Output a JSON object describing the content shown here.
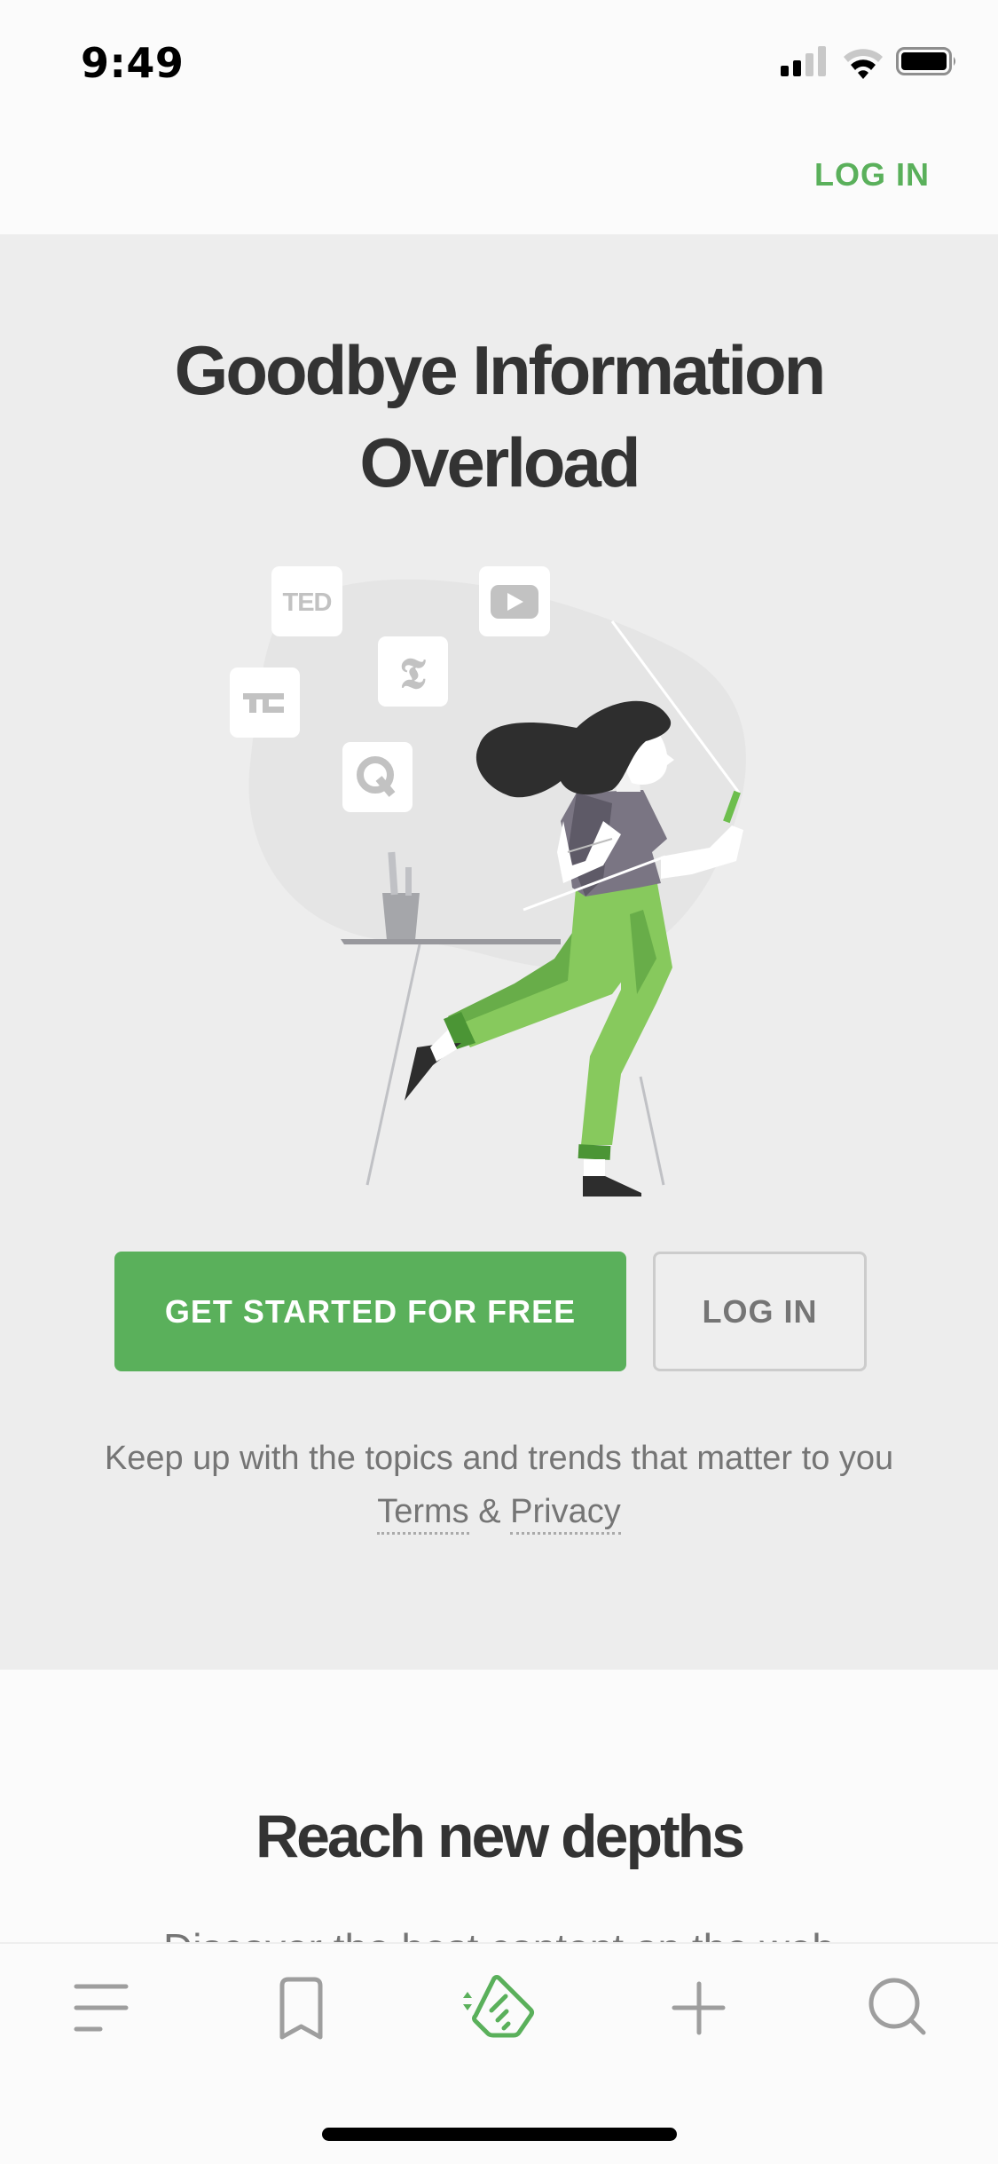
{
  "status_bar": {
    "time": "9:49",
    "signal_bars_active": 2,
    "signal_bars_total": 4,
    "wifi_level": 2,
    "battery_level": 1.0
  },
  "header": {
    "login_link": "LOG IN"
  },
  "hero": {
    "title_line1": "Goodbye Information",
    "title_line2": "Overload",
    "illustration": {
      "description": "woman walking away from desk holding phone",
      "source_logos": [
        "TED",
        "YouTube",
        "The New York Times",
        "TechCrunch",
        "Quartz"
      ],
      "logo_labels": {
        "ted": "TED",
        "techcrunch": "TC",
        "quartz": "Q"
      }
    },
    "cta_button": "GET STARTED FOR FREE",
    "login_button": "LOG IN",
    "tagline": "Keep up with the topics and trends that matter to you",
    "terms_link": "Terms",
    "ampersand": "&",
    "privacy_link": "Privacy"
  },
  "section2": {
    "title": "Reach new depths",
    "subtitle": "Discover the best content on the web"
  },
  "tabbar": {
    "items": [
      {
        "name": "menu",
        "icon": "menu-icon",
        "active": false
      },
      {
        "name": "saved",
        "icon": "bookmark-icon",
        "active": false
      },
      {
        "name": "feeds",
        "icon": "feedly-icon",
        "active": true
      },
      {
        "name": "add",
        "icon": "plus-icon",
        "active": false
      },
      {
        "name": "search",
        "icon": "search-icon",
        "active": false
      }
    ]
  },
  "colors": {
    "brand_green": "#5ab05b",
    "text_dark": "#333333",
    "text_gray": "#757575",
    "icon_gray": "#9e9e9e",
    "hero_bg": "#ededed"
  }
}
